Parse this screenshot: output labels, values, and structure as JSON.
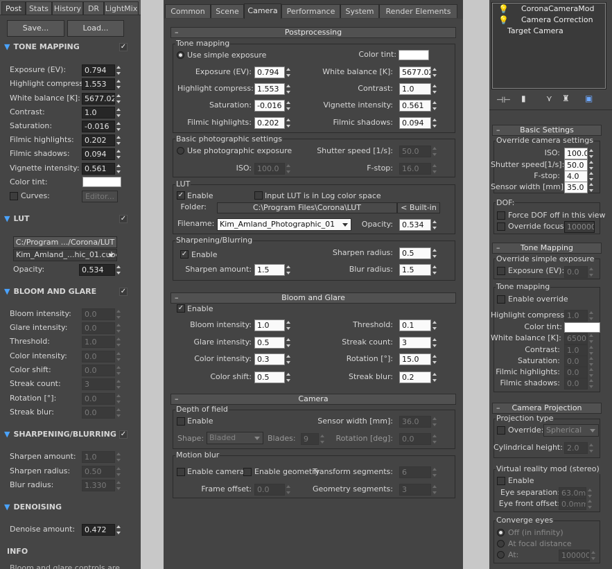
{
  "left": {
    "tabs": [
      "Post",
      "Stats",
      "History",
      "DR",
      "LightMix"
    ],
    "save": "Save...",
    "load": "Load...",
    "tone_title": "TONE MAPPING",
    "tone_rows": [
      [
        "Exposure (EV):",
        "0.794"
      ],
      [
        "Highlight compress:",
        "1.553"
      ],
      [
        "White balance [K]:",
        "5677.025"
      ],
      [
        "Contrast:",
        "1.0"
      ],
      [
        "Saturation:",
        "-0.016"
      ],
      [
        "Filmic highlights:",
        "0.202"
      ],
      [
        "Filmic shadows:",
        "0.094"
      ],
      [
        "Vignette intensity:",
        "0.561"
      ]
    ],
    "color_tint": "Color tint:",
    "curves": "Curves:",
    "editor": "Editor...",
    "lut_title": "LUT",
    "lut_path": "C:/Program .../Corona/LUT",
    "lut_file": "Kim_Amland_...hic_01.cube",
    "opacity_label": "Opacity:",
    "opacity": "0.534",
    "bloom_title": "BLOOM AND GLARE",
    "bloom_rows": [
      [
        "Bloom intensity:",
        "0.0"
      ],
      [
        "Glare intensity:",
        "0.0"
      ],
      [
        "Threshold:",
        "1.0"
      ],
      [
        "Color intensity:",
        "0.0"
      ],
      [
        "Color shift:",
        "0.0"
      ],
      [
        "Streak count:",
        "3"
      ],
      [
        "Rotation [°]:",
        "0.0"
      ],
      [
        "Streak blur:",
        "0.0"
      ]
    ],
    "sharp_title": "SHARPENING/BLURRING",
    "sharp_rows": [
      [
        "Sharpen amount:",
        "1.0"
      ],
      [
        "Sharpen radius:",
        "0.50"
      ],
      [
        "Blur radius:",
        "1.330"
      ]
    ],
    "denoise_title": "DENOISING",
    "denoise_label": "Denoise amount:",
    "denoise": "0.472",
    "info_title": "INFO",
    "info_text": "Bloom and glare controls are"
  },
  "mid": {
    "tabs": [
      "Common",
      "Scene",
      "Camera",
      "Performance",
      "System",
      "Render Elements"
    ],
    "post_title": "Postprocessing",
    "tm_group": "Tone mapping",
    "simple_exp": "Use simple exposure",
    "color_tint": "Color tint:",
    "exposure": [
      "Exposure (EV):",
      "0.794"
    ],
    "wb": [
      "White balance [K]:",
      "5677.02"
    ],
    "hc": [
      "Highlight compress:",
      "1.553"
    ],
    "contrast": [
      "Contrast:",
      "1.0"
    ],
    "sat": [
      "Saturation:",
      "-0.016"
    ],
    "vig": [
      "Vignette intensity:",
      "0.561"
    ],
    "fh": [
      "Filmic highlights:",
      "0.202"
    ],
    "fs": [
      "Filmic shadows:",
      "0.094"
    ],
    "bps_group": "Basic photographic settings",
    "photo_exp": "Use photographic exposure",
    "shutter": [
      "Shutter speed [1/s]:",
      "50.0"
    ],
    "iso": [
      "ISO:",
      "100.0"
    ],
    "fstop": [
      "F-stop:",
      "16.0"
    ],
    "lut_group": "LUT",
    "enable": "Enable",
    "log_lut": "Input LUT is in Log color space",
    "folder_label": "Folder:",
    "folder": "C:\\Program Files\\Corona\\LUT",
    "builtin": "< Built-in",
    "filename_label": "Filename:",
    "filename": "Kim_Amland_Photographic_01",
    "opacity": [
      "Opacity:",
      "0.534"
    ],
    "sb_group": "Sharpening/Blurring",
    "sharpen_radius": [
      "Sharpen radius:",
      "0.5"
    ],
    "sharpen_amount": [
      "Sharpen amount:",
      "1.5"
    ],
    "blur_radius": [
      "Blur radius:",
      "1.5"
    ],
    "bg_title": "Bloom and Glare",
    "bloom": [
      "Bloom intensity:",
      "1.0"
    ],
    "threshold": [
      "Threshold:",
      "0.1"
    ],
    "glare": [
      "Glare intensity:",
      "0.5"
    ],
    "streak_count": [
      "Streak count:",
      "3"
    ],
    "color_int": [
      "Color intensity:",
      "0.3"
    ],
    "rotation": [
      "Rotation  [°]:",
      "15.0"
    ],
    "color_shift": [
      "Color shift:",
      "0.5"
    ],
    "streak_blur": [
      "Streak blur:",
      "0.2"
    ],
    "cam_title": "Camera",
    "dof_group": "Depth of field",
    "sensor": [
      "Sensor width [mm]:",
      "36.0"
    ],
    "shape_label": "Shape:",
    "shape": "Bladed",
    "blades": [
      "Blades:",
      "9"
    ],
    "dof_rot": [
      "Rotation [deg]:",
      "0.0"
    ],
    "mb_group": "Motion blur",
    "enable_camera": "Enable camera",
    "enable_geometry": "Enable geometry",
    "transform_seg": [
      "Transform segments:",
      "6"
    ],
    "frame_offset": [
      "Frame offset:",
      "0.0"
    ],
    "geometry_seg": [
      "Geometry segments:",
      "3"
    ]
  },
  "right": {
    "stack": [
      "CoronaCameraMod",
      "Camera Correction",
      "Target Camera"
    ],
    "basic_title": "Basic Settings",
    "override_group": "Override camera settings",
    "iso": [
      "ISO:",
      "100.0"
    ],
    "shutter": [
      "Shutter speed[1/s]:",
      "50.0"
    ],
    "fstop": [
      "F-stop:",
      "4.0"
    ],
    "sensor": [
      "Sensor width [mm]:",
      "35.0"
    ],
    "dof_group": "DOF:",
    "force_dof": "Force DOF off in this view",
    "override_focus": "Override focus:",
    "focus": "100000.",
    "tm_title": "Tone Mapping",
    "ose_group": "Override simple exposure",
    "exposure": [
      "Exposure (EV):",
      "0.0"
    ],
    "tm_group": "Tone mapping",
    "enable_override": "Enable override",
    "hc": [
      "Highlight compress:",
      "1.0"
    ],
    "tint": "Color tint:",
    "wb": [
      "White balance [K]:",
      "6500.0"
    ],
    "contrast": [
      "Contrast:",
      "1.0"
    ],
    "saturation": [
      "Saturation:",
      "0.0"
    ],
    "fh": [
      "Filmic highlights:",
      "0.0"
    ],
    "fs": [
      "Filmic shadows:",
      "0.0"
    ],
    "proj_title": "Camera Projection",
    "proj_group": "Projection type",
    "override": "Override:",
    "spherical": "Spherical",
    "cyl": [
      "Cylindrical height:",
      "2.0"
    ],
    "vr_group": "Virtual reality mod (stereo)",
    "enable": "Enable",
    "eye_sep": [
      "Eye separation:",
      "63.0mm"
    ],
    "eye_off": [
      "Eye front offset:",
      "0.0mm"
    ],
    "conv_group": "Converge eyes",
    "off": "Off (in infinity)",
    "focal": "At focal distance",
    "at": "At:",
    "at_val": "100000."
  }
}
